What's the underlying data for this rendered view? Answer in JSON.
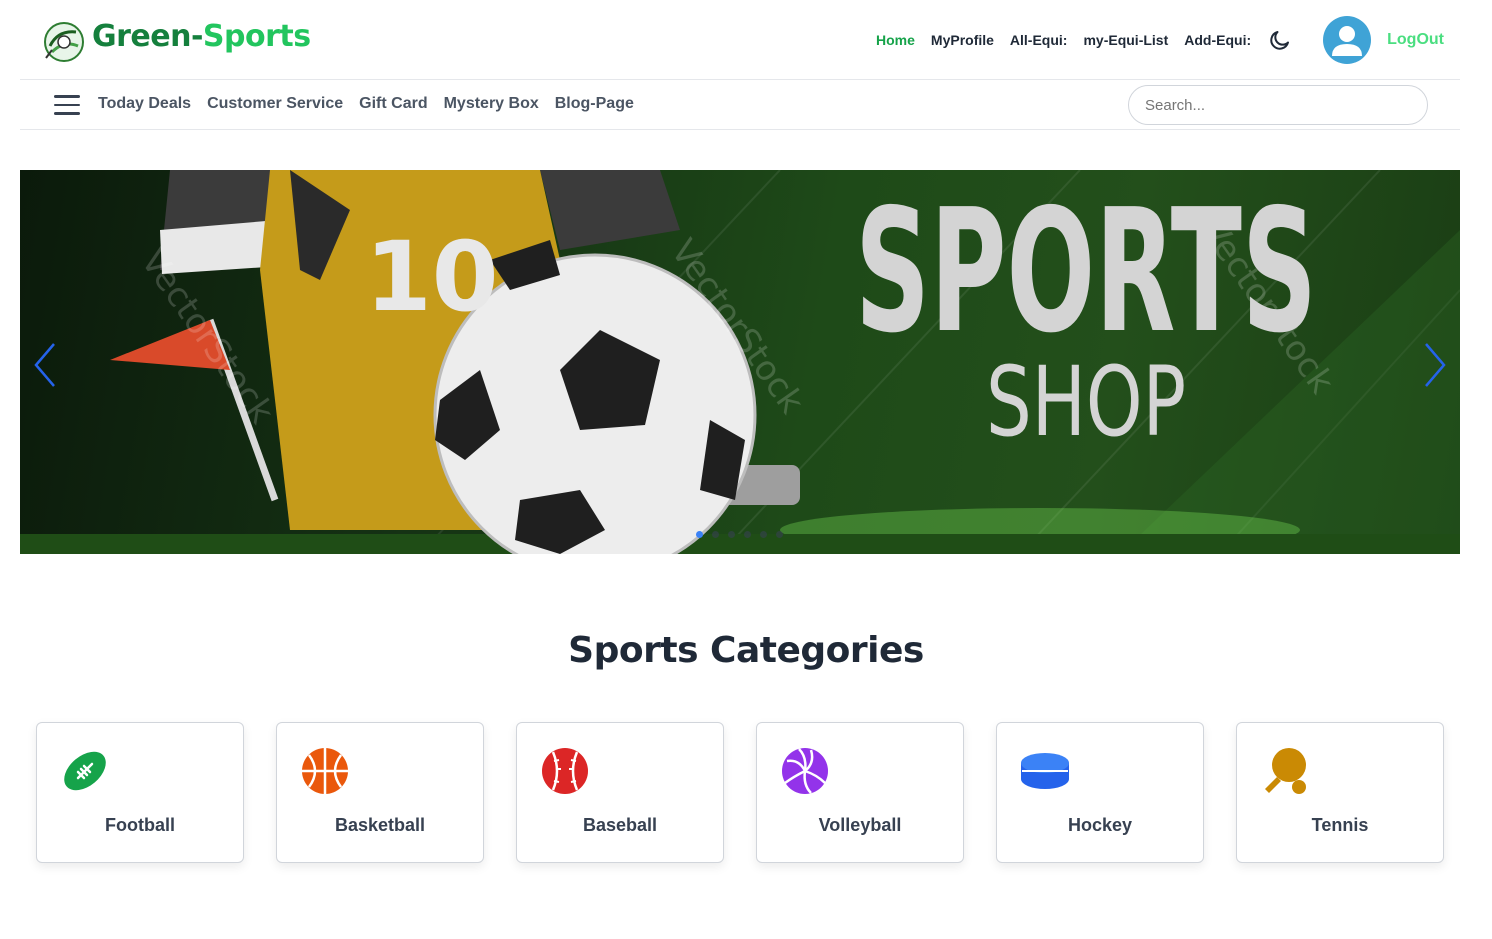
{
  "header": {
    "brand_part1": "Green-",
    "brand_part2": "Sports",
    "nav": [
      {
        "label": "Home",
        "active": true
      },
      {
        "label": "MyProfile"
      },
      {
        "label": "All-Equi:"
      },
      {
        "label": "my-Equi-List"
      },
      {
        "label": "Add-Equi:"
      }
    ],
    "logout_label": "LogOut",
    "theme_icon": "moon-icon",
    "avatar_icon": "user-avatar-icon"
  },
  "subnav": {
    "menu_icon": "hamburger-menu-icon",
    "links": [
      "Today Deals",
      "Customer Service",
      "Gift Card",
      "Mystery Box",
      "Blog-Page"
    ],
    "search_placeholder": "Search..."
  },
  "banner": {
    "headline": "SPORTS",
    "subheadline": "SHOP",
    "jersey_number": "10",
    "watermark": "VectorStock",
    "slide_count": 6,
    "active_slide": 1
  },
  "categories": {
    "title": "Sports Categories",
    "items": [
      {
        "label": "Football",
        "icon": "football-icon",
        "color": "#16a34a"
      },
      {
        "label": "Basketball",
        "icon": "basketball-icon",
        "color": "#ea580c"
      },
      {
        "label": "Baseball",
        "icon": "baseball-icon",
        "color": "#dc2626"
      },
      {
        "label": "Volleyball",
        "icon": "volleyball-icon",
        "color": "#9333ea"
      },
      {
        "label": "Hockey",
        "icon": "hockey-puck-icon",
        "color": "#2563eb"
      },
      {
        "label": "Tennis",
        "icon": "table-tennis-icon",
        "color": "#ca8a04"
      }
    ]
  },
  "colors": {
    "brand_dark": "#15803d",
    "brand_light": "#22c55e",
    "active_nav": "#16a34a",
    "logout": "#4ade80",
    "carousel_arrow": "#2563eb"
  }
}
